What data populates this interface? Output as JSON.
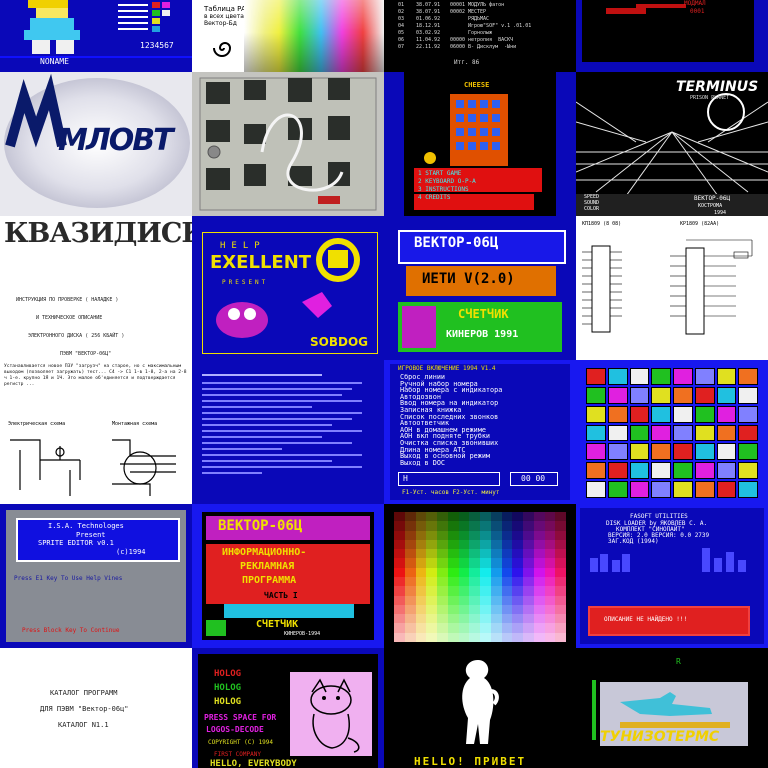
{
  "thumbnails": [
    {
      "id": "r0c0",
      "caption": "NONAME",
      "digits": "1234567"
    },
    {
      "id": "r0c1",
      "heading": "Таблица PAL",
      "sub1": "в всех цвета",
      "sub2": "Вектор-Бд"
    },
    {
      "id": "r0c2",
      "rows": [
        [
          "01",
          "38.07.91",
          "00001",
          "МОДУЛЬ фатон"
        ],
        [
          "02",
          "38.07.91",
          "00002",
          "МЕСТЕР"
        ],
        [
          "03",
          "01.06.92",
          "",
          "РЯДЬМАС"
        ],
        [
          "04",
          "18.12.91",
          "",
          "Игрою\"SOF\" v.1 .01.01"
        ],
        [
          "05",
          "03.02.92",
          "",
          "Горнолыж"
        ],
        [
          "06",
          "11.04.92",
          "00000",
          "нетропия  ВАСКЧ"
        ],
        [
          "07",
          "22.11.92",
          "06000",
          "В- Дисклум  -Ыни"
        ]
      ],
      "footer": "Итг. 86"
    },
    {
      "id": "r0c3",
      "line1": "МОДМАЛ",
      "line2": "0001"
    },
    {
      "id": "r1c0",
      "logo": "МЛОВТ"
    },
    {
      "id": "r1c1",
      "caption": ""
    },
    {
      "id": "r1c2",
      "title": "CHEESE",
      "menu": [
        "1 START GAME",
        "2 KEYBOARD  O-P-A",
        "3 INSTRUCTIONS",
        "4 CREDITS"
      ]
    },
    {
      "id": "r1c3",
      "title": "TERMINUS",
      "sub": "PRISON PLANET",
      "bottom1": "ВЕКТОР-06Ц",
      "bottom2": "КОСТРОМА",
      "year": "1994",
      "opts": [
        "SPEED",
        "SOUND",
        "COLOR"
      ]
    },
    {
      "id": "r2c0",
      "logo": "КВАЗИДИСК",
      "text1": "ИНСТРУКЦИЯ ПО ПРОВЕРКЕ ( НАЛАДКЕ )",
      "text2": "И ТЕХНИЧЕСКОЕ ОПИСАНИЕ",
      "text3": "ЭЛЕКТРОННОГО ДИСКА ( 256 КБАЙТ )",
      "text4": "ПЭВМ \"ВЕКТОР-06Ц\"",
      "body": "Устанавливается новое ПЗУ \"загрузч\" на старое, но с максимальным выходом (позволяет загружать) тест... С4 -> С1 1-в 1-8, 2-а на 2-8 ч 1-е. крупно 1Я и 1Ч. Это малое об'единяется и подтверждается регистр ...",
      "caption1": "Электрическая схема",
      "caption2": "Монтажная схема"
    },
    {
      "id": "r2c1",
      "title1": "HELP",
      "title2": "EXELLENT",
      "sub": "PRESENT",
      "bottom": "SOBDOG"
    },
    {
      "id": "r2c2",
      "line1": "ВЕКТОР-06Ц",
      "line2": "ИЕТИ V(2.0)",
      "line3": "СЧЕТЧИК",
      "line4": "КИНЕРОВ 1991"
    },
    {
      "id": "r2c3",
      "chip1": "КП1809 (8 08)",
      "chip2": "КР1809 (82АА)"
    },
    {
      "id": "r3c0",
      "text": ""
    },
    {
      "id": "r3c1",
      "text": ""
    },
    {
      "id": "r3c2",
      "header": "ИГРОВОЕ ВКЛЮЧЕНИЕ 1994 V1.4",
      "items": [
        "Сброс линии",
        "Ручной набор номера",
        "Набор номера с индикатора",
        "Автодозвон",
        "Ввод номера на индикатор",
        "Записная книжка",
        "Список последних звонков",
        "Автоответчик",
        "АОН в домашнем режиме",
        "АОН вкл подняте трубки",
        "Очистка списка звонивших",
        "Длина номера АТС",
        "Выход в основной режим",
        "Выход в DOC"
      ],
      "input": "Н",
      "time": "00 00",
      "footer": "F1-Уст. часов  F2-Уст. минут"
    },
    {
      "id": "r3c3",
      "text": ""
    },
    {
      "id": "r4c0",
      "box1": "I.S.A. Technologes",
      "box2": "Present",
      "box3": "SPRITE EDITOR v0.1",
      "box4": "(c)1994",
      "mid": "Press  E1 Key To Use Help Vines",
      "bottom": "Press Block Key To Continue"
    },
    {
      "id": "r4c1",
      "top": "ВЕКТОР-06Ц",
      "mid1": "ИНФОРМАЦИОННО-",
      "mid2": "РЕКЛАМНАЯ",
      "mid3": "ПРОГРАММА",
      "part": "ЧАСТЬ I",
      "brand": "СЧЕТЧИК",
      "year": "КИНЕРОВ-1994"
    },
    {
      "id": "r4c2",
      "text": ""
    },
    {
      "id": "r4c3",
      "l1": "FASOFT UTILITIES",
      "l2": "DISK LOADER by ЯКОВЛЕВ С. А.",
      "l3": "КОМПЛЕКТ \"СИНОПАЙТ\"",
      "l4": "ВЕРСИЯ: 2.0 ВЕРСИЯ: 0.0 2739",
      "l5": "ЗАГ.КОД (1994)",
      "box": "ОПИСАНИЕ НЕ НАЙДЕНО !!!"
    },
    {
      "id": "r5c0",
      "l1": "КАТАЛОГ ПРОГРАММ",
      "l2": "ДЛЯ ПЭВМ \"Вектор-06ц\"",
      "l3": "КАТАЛОГ  N1.1"
    },
    {
      "id": "r5c1",
      "l1": "HOLOG",
      "l2": "PRESS SPACE FOR",
      "l3": "LOGOS-DECODE",
      "l4": "COPYRIGHT (C) 1994",
      "l5": "FIRST COMPANY",
      "bottom": "HELLO, EVERYBODY"
    },
    {
      "id": "r5c2",
      "text": "HELLO! ПРИВЕТ"
    },
    {
      "id": "r5c3",
      "top": "R",
      "title": "ТУНИЗОТЕРМС"
    }
  ],
  "colors": {
    "vector_blue": "#0a08b8",
    "border_blue": "#1818f0",
    "amber": "#f0c000",
    "red": "#e01010",
    "green": "#20c020",
    "magenta": "#e020e0",
    "cyan": "#20d0f0"
  }
}
